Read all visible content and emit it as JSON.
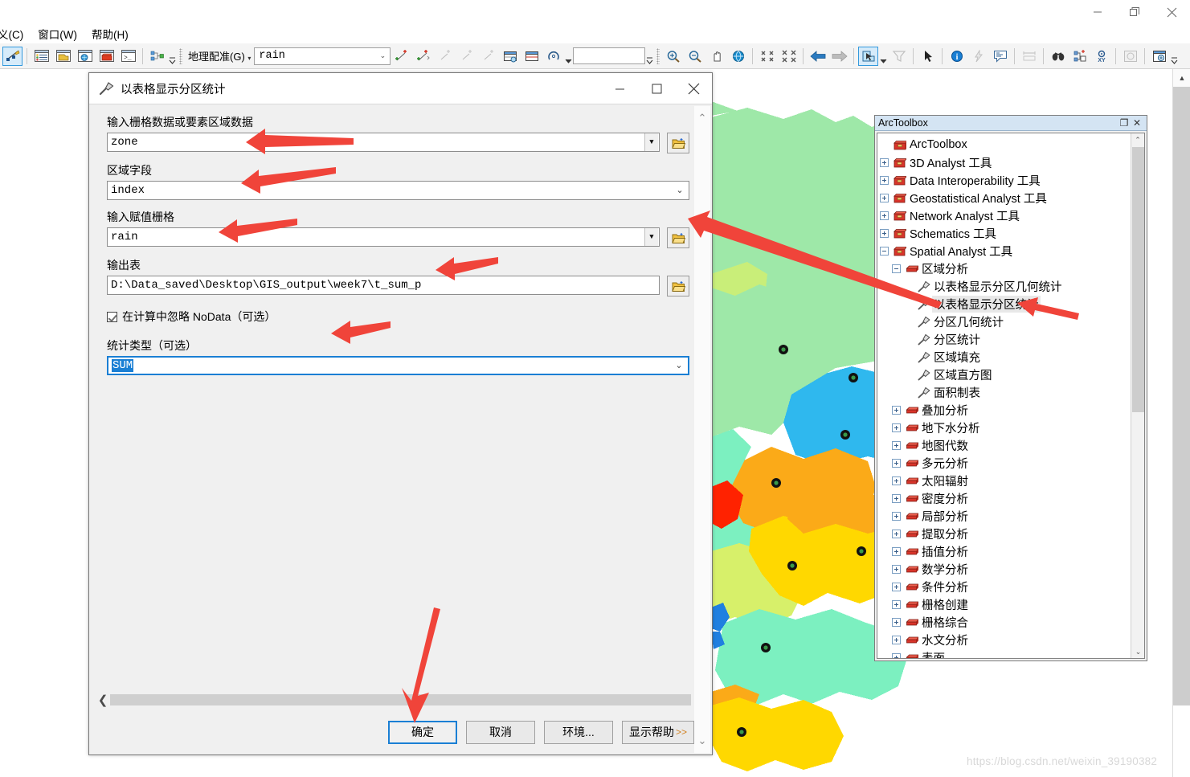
{
  "window": {
    "minimize_label": "minimize",
    "restore_label": "restore",
    "close_label": "close"
  },
  "menubar": {
    "items": [
      {
        "label": "义(C)",
        "name": "menu-custom"
      },
      {
        "label": "窗口(W)",
        "name": "menu-window"
      },
      {
        "label": "帮助(H)",
        "name": "menu-help"
      }
    ]
  },
  "toolbar": {
    "georef_label": "地理配准(G)",
    "layer_combo_value": "rain",
    "blank_input_value": "",
    "icons": [
      "editor-toolbar-icon",
      "table-of-contents-icon",
      "catalog-icon",
      "search-icon",
      "arctoolbox-icon",
      "python-window-icon",
      "modelbuilder-icon"
    ]
  },
  "dialog": {
    "title": "以表格显示分区统计",
    "title_icon": "hammer-icon",
    "fields": [
      {
        "label": "输入栅格数据或要素区域数据",
        "value": "zone",
        "type": "combo-browse",
        "name": "input-zone-raster"
      },
      {
        "label": "区域字段",
        "value": "index",
        "type": "combo",
        "name": "zone-field"
      },
      {
        "label": "输入赋值栅格",
        "value": "rain",
        "type": "combo-browse",
        "name": "input-value-raster"
      },
      {
        "label": "输出表",
        "value": "D:\\Data_saved\\Desktop\\GIS_output\\week7\\t_sum_p",
        "type": "text-browse",
        "name": "output-table"
      }
    ],
    "checkbox": {
      "label": "在计算中忽略 NoData（可选）",
      "checked": true,
      "name": "ignore-nodata-checkbox"
    },
    "stat_type": {
      "label": "统计类型（可选）",
      "value": "SUM",
      "name": "statistics-type"
    },
    "buttons": [
      {
        "label": "确定",
        "name": "ok-button",
        "primary": true
      },
      {
        "label": "取消",
        "name": "cancel-button",
        "primary": false
      },
      {
        "label": "环境...",
        "name": "environments-button",
        "primary": false
      },
      {
        "label": "显示帮助",
        "suffix": ">>",
        "name": "show-help-button",
        "primary": false
      }
    ]
  },
  "arctoolbox": {
    "panel_title": "ArcToolbox",
    "tree": [
      {
        "label": "ArcToolbox",
        "depth": 0,
        "toggle": "none",
        "icon": "toolbox-root-icon",
        "name": "tree-arctoolbox-root"
      },
      {
        "label": "3D Analyst 工具",
        "depth": 1,
        "toggle": "plus",
        "icon": "toolbox-icon",
        "name": "tree-3d-analyst"
      },
      {
        "label": "Data Interoperability 工具",
        "depth": 1,
        "toggle": "plus",
        "icon": "toolbox-icon",
        "name": "tree-data-interoperability"
      },
      {
        "label": "Geostatistical Analyst 工具",
        "depth": 1,
        "toggle": "plus",
        "icon": "toolbox-icon",
        "name": "tree-geostatistical-analyst"
      },
      {
        "label": "Network Analyst 工具",
        "depth": 1,
        "toggle": "plus",
        "icon": "toolbox-icon",
        "name": "tree-network-analyst"
      },
      {
        "label": "Schematics 工具",
        "depth": 1,
        "toggle": "plus",
        "icon": "toolbox-icon",
        "name": "tree-schematics"
      },
      {
        "label": "Spatial Analyst 工具",
        "depth": 1,
        "toggle": "minus",
        "icon": "toolbox-icon",
        "name": "tree-spatial-analyst"
      },
      {
        "label": "区域分析",
        "depth": 2,
        "toggle": "minus",
        "icon": "toolset-icon",
        "name": "tree-zonal-analysis"
      },
      {
        "label": "以表格显示分区几何统计",
        "depth": 3,
        "toggle": "none",
        "icon": "hammer-icon",
        "name": "tree-zonal-geometry-as-table"
      },
      {
        "label": "以表格显示分区统计",
        "depth": 3,
        "toggle": "none",
        "icon": "hammer-icon",
        "selected": true,
        "name": "tree-zonal-statistics-as-table"
      },
      {
        "label": "分区几何统计",
        "depth": 3,
        "toggle": "none",
        "icon": "hammer-icon",
        "name": "tree-zonal-geometry"
      },
      {
        "label": "分区统计",
        "depth": 3,
        "toggle": "none",
        "icon": "hammer-icon",
        "name": "tree-zonal-statistics"
      },
      {
        "label": "区域填充",
        "depth": 3,
        "toggle": "none",
        "icon": "hammer-icon",
        "name": "tree-zonal-fill"
      },
      {
        "label": "区域直方图",
        "depth": 3,
        "toggle": "none",
        "icon": "hammer-icon",
        "name": "tree-zonal-histogram"
      },
      {
        "label": "面积制表",
        "depth": 3,
        "toggle": "none",
        "icon": "hammer-icon",
        "name": "tree-tabulate-area"
      },
      {
        "label": "叠加分析",
        "depth": 2,
        "toggle": "plus",
        "icon": "toolset-icon",
        "name": "tree-overlay-analysis"
      },
      {
        "label": "地下水分析",
        "depth": 2,
        "toggle": "plus",
        "icon": "toolset-icon",
        "name": "tree-groundwater"
      },
      {
        "label": "地图代数",
        "depth": 2,
        "toggle": "plus",
        "icon": "toolset-icon",
        "name": "tree-map-algebra"
      },
      {
        "label": "多元分析",
        "depth": 2,
        "toggle": "plus",
        "icon": "toolset-icon",
        "name": "tree-multivariate"
      },
      {
        "label": "太阳辐射",
        "depth": 2,
        "toggle": "plus",
        "icon": "toolset-icon",
        "name": "tree-solar-radiation"
      },
      {
        "label": "密度分析",
        "depth": 2,
        "toggle": "plus",
        "icon": "toolset-icon",
        "name": "tree-density"
      },
      {
        "label": "局部分析",
        "depth": 2,
        "toggle": "plus",
        "icon": "toolset-icon",
        "name": "tree-local"
      },
      {
        "label": "提取分析",
        "depth": 2,
        "toggle": "plus",
        "icon": "toolset-icon",
        "name": "tree-extraction"
      },
      {
        "label": "插值分析",
        "depth": 2,
        "toggle": "plus",
        "icon": "toolset-icon",
        "name": "tree-interpolation"
      },
      {
        "label": "数学分析",
        "depth": 2,
        "toggle": "plus",
        "icon": "toolset-icon",
        "name": "tree-math"
      },
      {
        "label": "条件分析",
        "depth": 2,
        "toggle": "plus",
        "icon": "toolset-icon",
        "name": "tree-conditional"
      },
      {
        "label": "栅格创建",
        "depth": 2,
        "toggle": "plus",
        "icon": "toolset-icon",
        "name": "tree-raster-creation"
      },
      {
        "label": "栅格综合",
        "depth": 2,
        "toggle": "plus",
        "icon": "toolset-icon",
        "name": "tree-generalization"
      },
      {
        "label": "水文分析",
        "depth": 2,
        "toggle": "plus",
        "icon": "toolset-icon",
        "name": "tree-hydrology"
      },
      {
        "label": "表面",
        "depth": 2,
        "toggle": "plus",
        "icon": "toolset-icon",
        "name": "tree-surface"
      }
    ]
  },
  "map": {
    "colors": {
      "light_green": "#9ee8a8",
      "mint": "#7cf0c0",
      "yellow_green": "#d7f06a",
      "sky_blue": "#2fb8ee",
      "blue": "#1f7fe0",
      "orange": "#fbaa18",
      "yellow": "#ffd800",
      "gold": "#ffcc00",
      "red": "#ff2200",
      "white": "#ffffff"
    }
  },
  "annotations": {
    "arrow_color": "#f0443a",
    "count": 6
  },
  "watermark": {
    "text": "https://blog.csdn.net/weixin_39190382"
  }
}
